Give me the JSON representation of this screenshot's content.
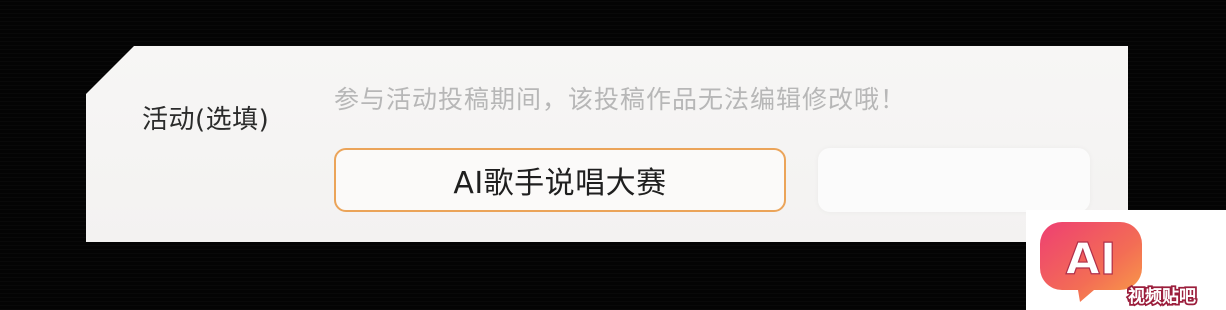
{
  "activity_field": {
    "label": "活动(选填)",
    "hint": "参与活动投稿期间，该投稿作品无法编辑修改哦！",
    "options": [
      {
        "label": "AI歌手说唱大赛",
        "selected": true
      },
      {
        "label": "",
        "selected": false
      }
    ]
  },
  "watermark": {
    "logo_text": "AI",
    "caption": "视频贴吧"
  },
  "colors": {
    "selected_border": "#eba459",
    "logo_red": "#f0506a",
    "logo_orange": "#f99646"
  }
}
